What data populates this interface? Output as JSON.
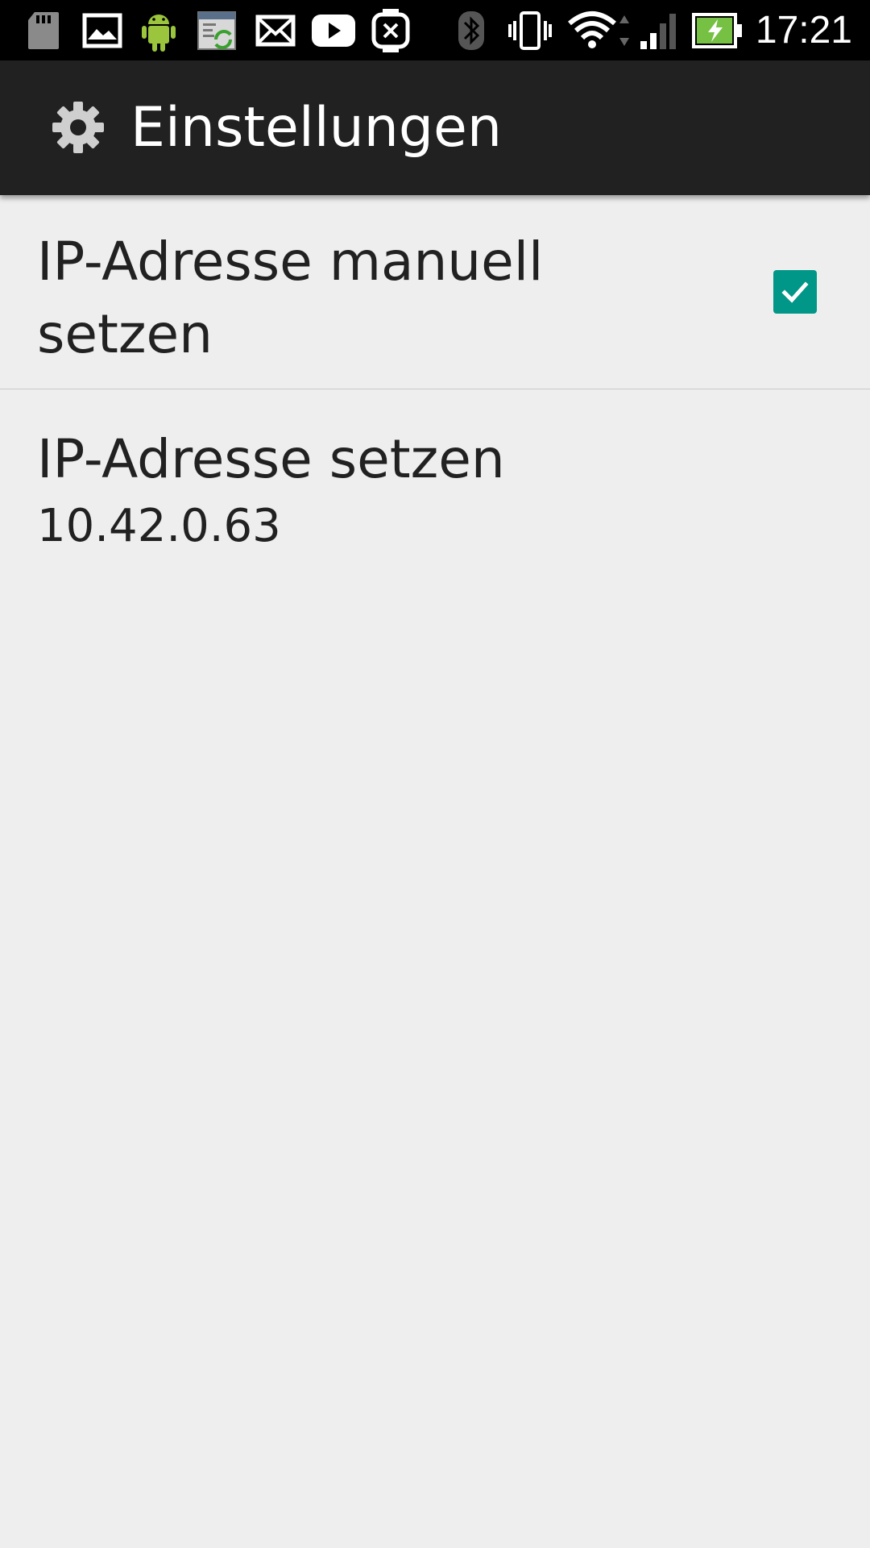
{
  "status_bar": {
    "time": "17:21",
    "icons": [
      "sd-card-icon",
      "gallery-icon",
      "android-icon",
      "sync-app-icon",
      "mail-icon",
      "youtube-icon",
      "watch-icon",
      "bluetooth-icon",
      "vibrate-icon",
      "wifi-icon",
      "signal-icon",
      "battery-charging-icon"
    ],
    "colors": {
      "battery_fill": "#76c043",
      "android_green": "#9bc53d"
    }
  },
  "action_bar": {
    "title": "Einstellungen",
    "icon": "settings-gear-icon"
  },
  "preferences": [
    {
      "title": "IP-Adresse manuell setzen",
      "checked": true
    },
    {
      "title": "IP-Adresse setzen",
      "summary": "10.42.0.63"
    }
  ],
  "colors": {
    "accent": "#009688",
    "action_bar_bg": "#212121",
    "background": "#eeeeee",
    "text": "#212121"
  }
}
